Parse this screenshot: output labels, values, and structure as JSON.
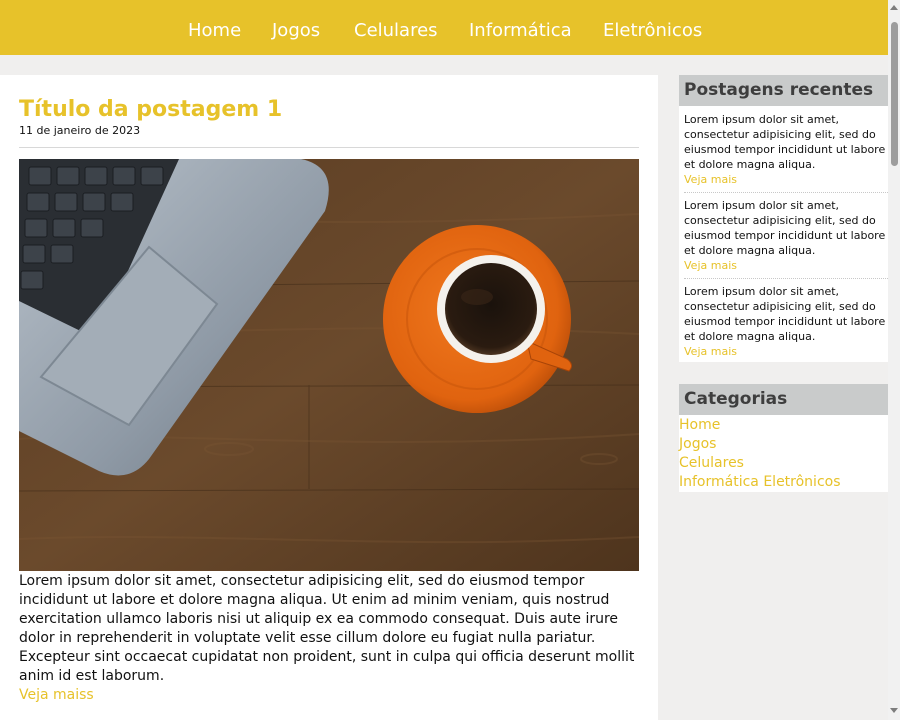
{
  "nav": {
    "items": [
      {
        "label": "Home"
      },
      {
        "label": "Jogos"
      },
      {
        "label": "Celulares"
      },
      {
        "label": "Informática"
      },
      {
        "label": "Eletrônicos"
      }
    ]
  },
  "post": {
    "title": "Título da postagem 1",
    "date": "11 de janeiro de 2023",
    "body": "Lorem ipsum dolor sit amet, consectetur adipisicing elit, sed do eiusmod tempor incididunt ut labore et dolore magna aliqua. Ut enim ad minim veniam, quis nostrud exercitation ullamco laboris nisi ut aliquip ex ea commodo consequat. Duis aute irure dolor in reprehenderit in voluptate velit esse cillum dolore eu fugiat nulla pariatur. Excepteur sint occaecat cupidatat non proident, sunt in culpa qui officia deserunt mollit anim id est laborum.",
    "more_label": "Veja maiss"
  },
  "recent": {
    "title": "Postagens recentes",
    "items": [
      {
        "text": "Lorem ipsum dolor sit amet, consectetur adipisicing elit, sed do eiusmod tempor incididunt ut labore et dolore magna aliqua.",
        "more": "Veja mais"
      },
      {
        "text": "Lorem ipsum dolor sit amet, consectetur adipisicing elit, sed do eiusmod tempor incididunt ut labore et dolore magna aliqua.",
        "more": "Veja mais"
      },
      {
        "text": "Lorem ipsum dolor sit amet, consectetur adipisicing elit, sed do eiusmod tempor incididunt ut labore et dolore magna aliqua.",
        "more": "Veja mais"
      }
    ]
  },
  "categories": {
    "title": "Categorias",
    "items": [
      {
        "label": "Home"
      },
      {
        "label": "Jogos"
      },
      {
        "label": "Celulares"
      },
      {
        "label": "Informática Eletrônicos"
      }
    ]
  },
  "colors": {
    "accent": "#e7c22a",
    "widget_header": "#c9cbcb",
    "page_background": "#f0efee"
  }
}
